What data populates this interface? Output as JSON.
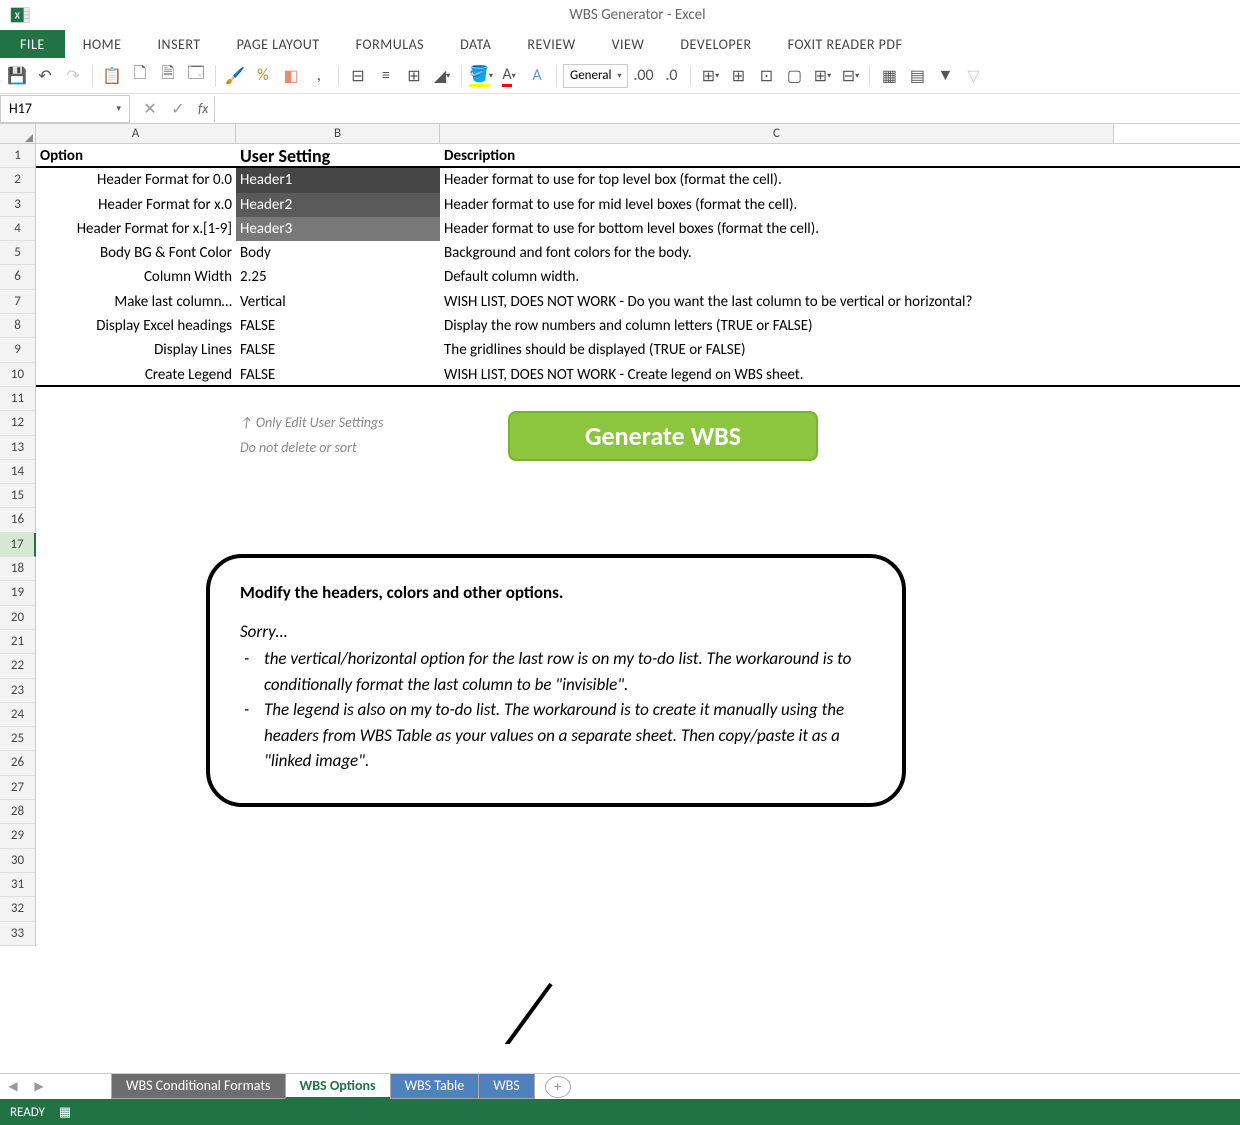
{
  "app": {
    "title": "WBS Generator - Excel"
  },
  "ribbon": {
    "file": "FILE",
    "tabs": [
      "HOME",
      "INSERT",
      "PAGE LAYOUT",
      "FORMULAS",
      "DATA",
      "REVIEW",
      "VIEW",
      "DEVELOPER",
      "FOXIT READER PDF"
    ]
  },
  "toolbar": {
    "number_format": "General"
  },
  "formula_bar": {
    "name_box": "H17",
    "fx": "fx",
    "formula": ""
  },
  "columns": [
    "A",
    "B",
    "C"
  ],
  "headers": {
    "option": "Option",
    "user_setting": "User Setting",
    "description": "Description"
  },
  "rows": [
    {
      "n": 2,
      "option": "Header Format for 0.0",
      "setting": "Header1",
      "desc": "Header format to use for top level box (format the cell).",
      "cls": "header-cell-1"
    },
    {
      "n": 3,
      "option": "Header Format for x.0",
      "setting": "Header2",
      "desc": "Header format to use for mid level boxes (format the cell).",
      "cls": "header-cell-2"
    },
    {
      "n": 4,
      "option": "Header Format for x.[1-9]",
      "setting": "Header3",
      "desc": "Header format to use for bottom level boxes (format the cell).",
      "cls": "header-cell-3"
    },
    {
      "n": 5,
      "option": "Body BG & Font Color",
      "setting": "Body",
      "desc": "Background and font colors for the body.",
      "cls": ""
    },
    {
      "n": 6,
      "option": "Column Width",
      "setting": "2.25",
      "desc": "Default column width.",
      "cls": ""
    },
    {
      "n": 7,
      "option": "Make last column…",
      "setting": "Vertical",
      "desc": "WISH LIST, DOES NOT WORK - Do you want the last column to be vertical or horizontal?",
      "cls": ""
    },
    {
      "n": 8,
      "option": "Display Excel headings",
      "setting": "FALSE",
      "desc": "Display the row numbers and column letters (TRUE or FALSE)",
      "cls": ""
    },
    {
      "n": 9,
      "option": "Display Lines",
      "setting": "FALSE",
      "desc": "The gridlines should be displayed (TRUE or FALSE)",
      "cls": ""
    },
    {
      "n": 10,
      "option": "Create Legend",
      "setting": "FALSE",
      "desc": "WISH LIST, DOES NOT WORK - Create legend on WBS sheet.",
      "cls": ""
    }
  ],
  "hints": {
    "line1": "↑  Only Edit User Settings",
    "line2": "Do not delete or sort"
  },
  "generate_btn": "Generate WBS",
  "callout": {
    "title": "Modify the headers, colors and other options.",
    "sorry": "Sorry…",
    "items": [
      "the vertical/horizontal option for the last row is on my to-do list. The workaround is to conditionally format the last column to be \"invisible\".",
      "The legend is also on my to-do list. The workaround is to create it manually using the headers from WBS Table as your values on a separate sheet. Then copy/paste it as a \"linked image\"."
    ]
  },
  "sheets": {
    "items": [
      {
        "label": "WBS Conditional Formats",
        "cls": "st-gray"
      },
      {
        "label": "WBS Options",
        "cls": "st-active"
      },
      {
        "label": "WBS Table",
        "cls": "st-blue"
      },
      {
        "label": "WBS",
        "cls": "st-blue"
      }
    ]
  },
  "status": {
    "ready": "READY"
  },
  "selected_row": 17,
  "row_count": 33
}
